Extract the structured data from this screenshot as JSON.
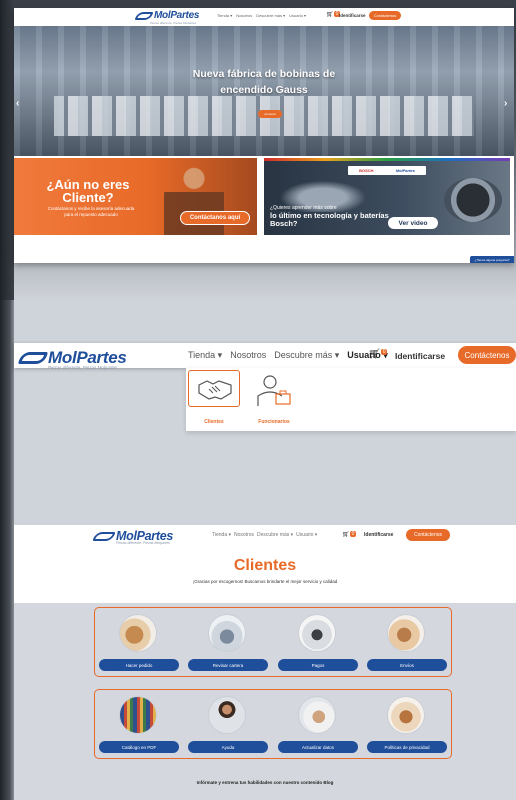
{
  "frame1": {
    "logo": {
      "text": "MolPartes",
      "tagline": "Piezas diferente, Piezas Molpartes"
    },
    "menu": [
      "Tienda ▾",
      "Nosotros",
      "Descubre más ▾",
      "Usuario ▾"
    ],
    "cart_count": "0",
    "login_label": "Identificarse",
    "contact_label": "Contáctenos",
    "hero": {
      "title_line1": "Nueva fábrica de bobinas de",
      "title_line2": "encendido Gauss",
      "button_label": "¡Conoce!"
    },
    "promo_left": {
      "heading_line1": "¿Aún no eres",
      "heading_line2": "Cliente?",
      "subtext_line1": "Contáctanos y recibe la asesoría adecuada",
      "subtext_line2": "para el repuesto adecuado",
      "button_label": "Contáctanos aquí"
    },
    "promo_right": {
      "brand1": "BOSCH",
      "brand2": "MolPartes",
      "line1": "¿Quieres aprender más sobre",
      "line2": "lo último en tecnología y baterías Bosch?",
      "button_label": "Ver video"
    },
    "chat_label": "¿Tienes alguna pregunta?"
  },
  "frame2": {
    "logo": {
      "text": "MolPartes",
      "tagline": "Piezas diferente, Piezas Molpartes"
    },
    "menu": {
      "tienda": "Tienda ▾",
      "nosotros": "Nosotros",
      "descubre": "Descubre más ▾",
      "usuario": "Usuario ▾"
    },
    "cart_count": "0",
    "login_label": "Identificarse",
    "contact_label": "Contáctenos",
    "dropdown": [
      {
        "label": "Clientes",
        "icon": "handshake-icon"
      },
      {
        "label": "Funcionarios",
        "icon": "employee-icon"
      }
    ]
  },
  "frame3": {
    "logo": {
      "text": "MolPartes",
      "tagline": "Piezas diferente, Piezas Molpartes"
    },
    "menu": [
      "Tienda ▾",
      "Nosotros",
      "Descubre más ▾",
      "Usuario ▾"
    ],
    "cart_count": "0",
    "login_label": "Identificarse",
    "contact_label": "Contáctenos",
    "title": "Clientes",
    "subtitle": "¡Gracias por escogernos! Buscamos brindarte el mejor servicio y calidad",
    "row1": [
      "Hacer pedido",
      "Revisar cartera",
      "Pagos",
      "Envíos"
    ],
    "row2": [
      "Catálogo en PDF",
      "Ayuda",
      "Actualizar datos",
      "Políticas de privacidad"
    ],
    "footer": "Infórmate  y entrena tus habilidades con nuestro contenido Blog"
  },
  "colors": {
    "accent": "#e86a28",
    "brand_blue": "#1f4e9b"
  }
}
